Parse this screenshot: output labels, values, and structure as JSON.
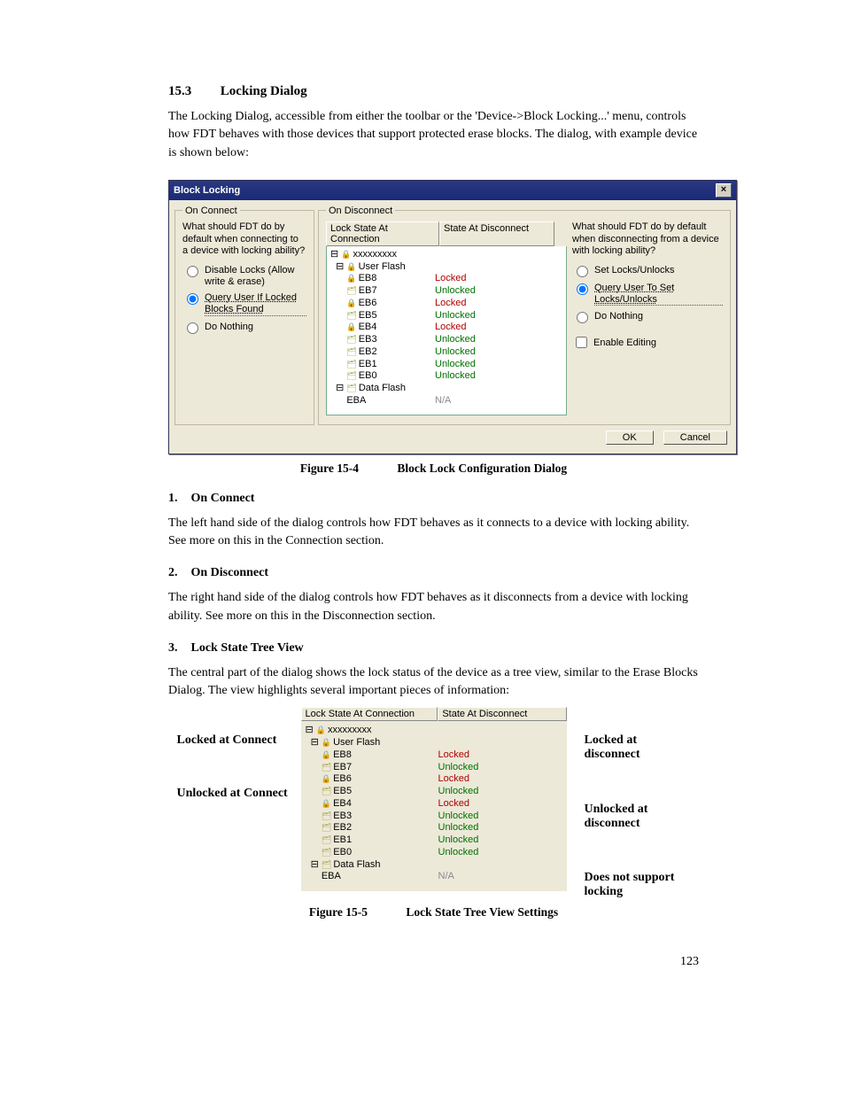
{
  "section": {
    "number": "15.3",
    "title": "Locking Dialog"
  },
  "intro": "The Locking Dialog, accessible from either the toolbar or the 'Device->Block Locking...' menu, controls how FDT behaves with those devices that support protected erase blocks. The dialog, with example device is shown below:",
  "dialog": {
    "title": "Block Locking",
    "onConnect": {
      "legend": "On Connect",
      "question": "What should FDT do by default when connecting to a device with locking ability?",
      "options": [
        {
          "label": "Disable Locks (Allow write & erase)",
          "selected": false
        },
        {
          "label": "Query User If Locked Blocks Found",
          "selected": true
        },
        {
          "label": "Do Nothing",
          "selected": false
        }
      ]
    },
    "onDisconnect": {
      "legend": "On Disconnect",
      "headers": {
        "c1": "Lock State At Connection",
        "c2": "State At Disconnect"
      },
      "root": "xxxxxxxxx",
      "userFlash": "User Flash",
      "rows": [
        {
          "name": "EB8",
          "state": "Locked",
          "lock": true
        },
        {
          "name": "EB7",
          "state": "Unlocked",
          "lock": false
        },
        {
          "name": "EB6",
          "state": "Locked",
          "lock": true
        },
        {
          "name": "EB5",
          "state": "Unlocked",
          "lock": false
        },
        {
          "name": "EB4",
          "state": "Locked",
          "lock": true
        },
        {
          "name": "EB3",
          "state": "Unlocked",
          "lock": false
        },
        {
          "name": "EB2",
          "state": "Unlocked",
          "lock": false
        },
        {
          "name": "EB1",
          "state": "Unlocked",
          "lock": false
        },
        {
          "name": "EB0",
          "state": "Unlocked",
          "lock": false
        }
      ],
      "dataFlash": "Data Flash",
      "dataFlashRow": {
        "name": "EBA",
        "state": "N/A"
      },
      "rightQuestion": "What should FDT do by default when disconnecting from a device with locking ability?",
      "rightOptions": [
        {
          "label": "Set Locks/Unlocks",
          "selected": false
        },
        {
          "label": "Query User To Set Locks/Unlocks",
          "selected": true
        },
        {
          "label": "Do Nothing",
          "selected": false
        }
      ],
      "enableEditing": "Enable Editing"
    },
    "buttons": {
      "ok": "OK",
      "cancel": "Cancel"
    }
  },
  "fig1": {
    "no": "Figure 15-4",
    "caption": "Block Lock Configuration Dialog"
  },
  "sub1": {
    "num": "1.",
    "title": "On Connect",
    "text": "The left hand side of the dialog controls how FDT behaves as it connects to a device with locking ability. See more on this in the Connection section."
  },
  "sub2": {
    "num": "2.",
    "title": "On Disconnect",
    "text": "The right hand side of the dialog controls how FDT behaves as it disconnects from a device with locking ability. See more on this in the Disconnection section."
  },
  "sub3": {
    "num": "3.",
    "title": "Lock State Tree View",
    "text": "The central part of the dialog shows the lock status of the device as a tree view, similar to the Erase Blocks Dialog. The view highlights several important pieces of information:"
  },
  "fig2": {
    "headers": {
      "c1": "Lock State At Connection",
      "c2": "State At Disconnect"
    },
    "root": "xxxxxxxxx",
    "userFlash": "User Flash",
    "rows": [
      {
        "name": "EB8",
        "state": "Locked",
        "lock": true
      },
      {
        "name": "EB7",
        "state": "Unlocked",
        "lock": false
      },
      {
        "name": "EB6",
        "state": "Locked",
        "lock": true
      },
      {
        "name": "EB5",
        "state": "Unlocked",
        "lock": false
      },
      {
        "name": "EB4",
        "state": "Locked",
        "lock": true
      },
      {
        "name": "EB3",
        "state": "Unlocked",
        "lock": false
      },
      {
        "name": "EB2",
        "state": "Unlocked",
        "lock": false
      },
      {
        "name": "EB1",
        "state": "Unlocked",
        "lock": false
      },
      {
        "name": "EB0",
        "state": "Unlocked",
        "lock": false
      }
    ],
    "dataFlash": "Data Flash",
    "dataFlashRow": {
      "name": "EBA",
      "state": "N/A"
    },
    "labels": {
      "lockedAtConnect": "Locked at Connect",
      "unlockedAtConnect": "Unlocked at Connect",
      "lockedAtDisc": "Locked at disconnect",
      "unlockedAtDisc": "Unlocked at disconnect",
      "noSupport": "Does not support locking"
    }
  },
  "fig2cap": {
    "no": "Figure 15-5",
    "caption": "Lock State Tree View Settings"
  },
  "pageNum": "123"
}
